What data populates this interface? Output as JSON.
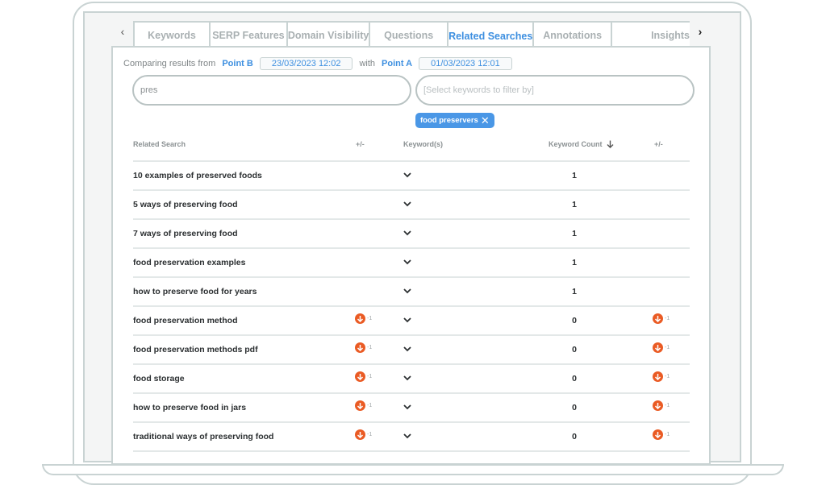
{
  "tabs": {
    "prev_icon": "chevron-left-icon",
    "next_icon": "chevron-right-icon",
    "items": [
      {
        "label": "Keywords",
        "active": false
      },
      {
        "label": "SERP Features",
        "active": false
      },
      {
        "label": "Domain Visibility",
        "active": false
      },
      {
        "label": "Questions",
        "active": false
      },
      {
        "label": "Related Searches",
        "active": true
      },
      {
        "label": "Annotations",
        "active": false
      },
      {
        "label": "Insights",
        "active": false
      }
    ]
  },
  "compare": {
    "prefix": "Comparing results from",
    "point_b_label": "Point B",
    "point_b_date": "23/03/2023 12:02",
    "with_label": "with",
    "point_a_label": "Point A",
    "point_a_date": "01/03/2023 12:01"
  },
  "search": {
    "value": "pres",
    "filter_placeholder": "[Select keywords to filter by]"
  },
  "filter_chips": [
    {
      "label": "food preservers",
      "remove_icon": "close-icon"
    }
  ],
  "table": {
    "headers": {
      "related_search": "Related Search",
      "change_1": "+/-",
      "keywords": "Keyword(s)",
      "keyword_count": "Keyword Count",
      "sort_icon": "arrow-down-icon",
      "change_2": "+/-"
    },
    "rows": [
      {
        "related_search": "10 examples of preserved foods",
        "change_1": "",
        "keyword_count": "1",
        "change_2": ""
      },
      {
        "related_search": "5 ways of preserving food",
        "change_1": "",
        "keyword_count": "1",
        "change_2": ""
      },
      {
        "related_search": "7 ways of preserving food",
        "change_1": "",
        "keyword_count": "1",
        "change_2": ""
      },
      {
        "related_search": "food preservation examples",
        "change_1": "",
        "keyword_count": "1",
        "change_2": ""
      },
      {
        "related_search": "how to preserve food for years",
        "change_1": "",
        "keyword_count": "1",
        "change_2": ""
      },
      {
        "related_search": "food preservation method",
        "change_1": "-1",
        "keyword_count": "0",
        "change_2": "-1"
      },
      {
        "related_search": "food preservation methods pdf",
        "change_1": "-1",
        "keyword_count": "0",
        "change_2": "-1"
      },
      {
        "related_search": "food storage",
        "change_1": "-1",
        "keyword_count": "0",
        "change_2": "-1"
      },
      {
        "related_search": "how to preserve food in jars",
        "change_1": "-1",
        "keyword_count": "0",
        "change_2": "-1"
      },
      {
        "related_search": "traditional ways of preserving food",
        "change_1": "-1",
        "keyword_count": "0",
        "change_2": "-1"
      }
    ]
  },
  "colors": {
    "accent": "#3d8fe0",
    "chip": "#4a97e6",
    "decrease": "#ea5b24",
    "frame": "#c9d3d3"
  }
}
